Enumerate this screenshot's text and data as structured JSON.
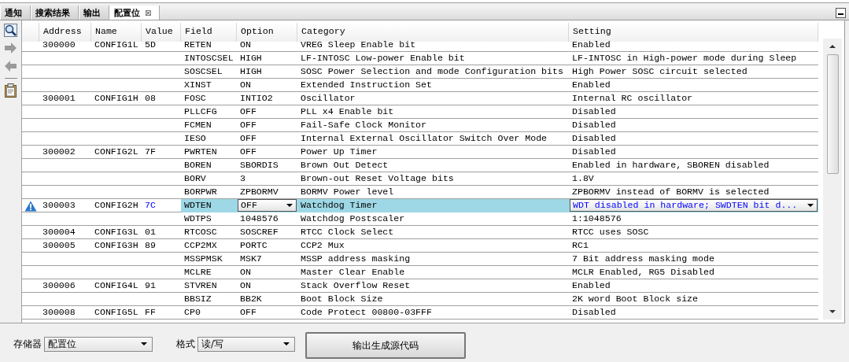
{
  "tabs": [
    {
      "label": "通知",
      "selected": false
    },
    {
      "label": "搜索结果",
      "selected": false
    },
    {
      "label": "输出",
      "selected": false
    },
    {
      "label": "配置位",
      "selected": true,
      "close_glyph": "⊠"
    }
  ],
  "table": {
    "columns": [
      "Address",
      "Name",
      "Value",
      "Field",
      "Option",
      "Category",
      "Setting"
    ],
    "rows": [
      {
        "address": "300000",
        "name": "CONFIG1L",
        "value": "5D",
        "value_modified": false,
        "field": "RETEN",
        "option": "ON",
        "category": "VREG Sleep Enable bit",
        "setting": "Enabled",
        "selected": false
      },
      {
        "field": "INTOSCSEL",
        "option": "HIGH",
        "category": "LF-INTOSC Low-power Enable bit",
        "setting": "LF-INTOSC in High-power mode during Sleep",
        "selected": false
      },
      {
        "field": "SOSCSEL",
        "option": "HIGH",
        "category": "SOSC Power Selection and mode Configuration bits",
        "setting": "High Power SOSC circuit selected",
        "selected": false
      },
      {
        "field": "XINST",
        "option": "ON",
        "category": "Extended Instruction Set",
        "setting": "Enabled",
        "selected": false
      },
      {
        "address": "300001",
        "name": "CONFIG1H",
        "value": "08",
        "value_modified": false,
        "field": "FOSC",
        "option": "INTIO2",
        "category": "Oscillator",
        "setting": "Internal RC oscillator",
        "selected": false
      },
      {
        "field": "PLLCFG",
        "option": "OFF",
        "category": "PLL x4 Enable bit",
        "setting": "Disabled",
        "selected": false
      },
      {
        "field": "FCMEN",
        "option": "OFF",
        "category": "Fail-Safe Clock Monitor",
        "setting": "Disabled",
        "selected": false
      },
      {
        "field": "IESO",
        "option": "OFF",
        "category": "Internal External Oscillator Switch Over Mode",
        "setting": "Disabled",
        "selected": false
      },
      {
        "address": "300002",
        "name": "CONFIG2L",
        "value": "7F",
        "value_modified": false,
        "field": "PWRTEN",
        "option": "OFF",
        "category": "Power Up Timer",
        "setting": "Disabled",
        "selected": false
      },
      {
        "field": "BOREN",
        "option": "SBORDIS",
        "category": "Brown Out Detect",
        "setting": "Enabled in hardware, SBOREN disabled",
        "selected": false
      },
      {
        "field": "BORV",
        "option": "3",
        "category": "Brown-out Reset Voltage bits",
        "setting": "1.8V",
        "selected": false
      },
      {
        "field": "BORPWR",
        "option": "ZPBORMV",
        "category": "BORMV Power level",
        "setting": "ZPBORMV instead of BORMV is selected",
        "selected": false
      },
      {
        "address": "300003",
        "name": "CONFIG2H",
        "value": "7C",
        "value_modified": true,
        "field": "WDTEN",
        "option": "OFF",
        "category": "Watchdog Timer",
        "setting": "WDT disabled in hardware; SWDTEN bit d...",
        "selected": true,
        "warning": true
      },
      {
        "field": "WDTPS",
        "option": "1048576",
        "category": "Watchdog Postscaler",
        "setting": "1:1048576",
        "selected": false
      },
      {
        "address": "300004",
        "name": "CONFIG3L",
        "value": "01",
        "value_modified": false,
        "field": "RTCOSC",
        "option": "SOSCREF",
        "category": "RTCC Clock Select",
        "setting": "RTCC uses SOSC",
        "selected": false
      },
      {
        "address": "300005",
        "name": "CONFIG3H",
        "value": "89",
        "value_modified": false,
        "field": "CCP2MX",
        "option": "PORTC",
        "category": "CCP2 Mux",
        "setting": "RC1",
        "selected": false
      },
      {
        "field": "MSSPMSK",
        "option": "MSK7",
        "category": "MSSP address masking",
        "setting": "7 Bit address masking mode",
        "selected": false
      },
      {
        "field": "MCLRE",
        "option": "ON",
        "category": "Master Clear Enable",
        "setting": "MCLR Enabled, RG5 Disabled",
        "selected": false
      },
      {
        "address": "300006",
        "name": "CONFIG4L",
        "value": "91",
        "value_modified": false,
        "field": "STVREN",
        "option": "ON",
        "category": "Stack Overflow Reset",
        "setting": "Enabled",
        "selected": false
      },
      {
        "field": "BBSIZ",
        "option": "BB2K",
        "category": "Boot Block Size",
        "setting": "2K word Boot Block size",
        "selected": false
      },
      {
        "address": "300008",
        "name": "CONFIG5L",
        "value": "FF",
        "value_modified": false,
        "field": "CP0",
        "option": "OFF",
        "category": "Code Protect 00800-03FFF",
        "setting": "Disabled",
        "selected": false
      }
    ]
  },
  "footer": {
    "memory_label": "存储器",
    "memory_value": "配置位",
    "format_label": "格式",
    "format_value": "读/写",
    "generate_button": "输出生成源代码"
  }
}
